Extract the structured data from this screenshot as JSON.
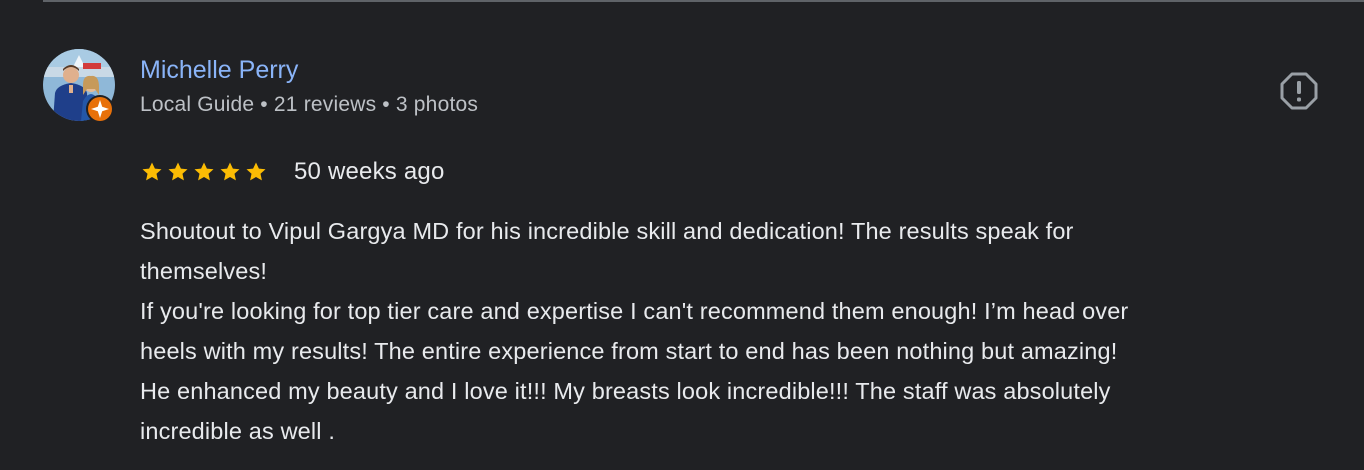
{
  "reviewer": {
    "name": "Michelle Perry",
    "meta": "Local Guide • 21 reviews • 3 photos",
    "avatar_icon": "profile-photo",
    "badge_icon": "local-guide-star-icon"
  },
  "report_icon": "report-flag-icon",
  "review": {
    "rating": 5,
    "rating_max": 5,
    "date": "50 weeks ago",
    "lines": [
      "Shoutout to Vipul Gargya MD for his incredible skill and dedication! The results speak for",
      "themselves!",
      "If you're looking for top tier care and expertise I can't recommend them enough! I’m head over",
      "heels with my results! The entire experience from start to end has been nothing but amazing!",
      "He enhanced my beauty and I love it!!! My breasts look incredible!!! The staff was absolutely",
      "incredible as well ."
    ]
  },
  "colors": {
    "background": "#202124",
    "name_link": "#8ab4f8",
    "meta_text": "#bdc1c6",
    "body_text": "#e8eaed",
    "star": "#fbbc04",
    "badge": "#e8710a",
    "icon_gray": "#9aa0a6"
  }
}
